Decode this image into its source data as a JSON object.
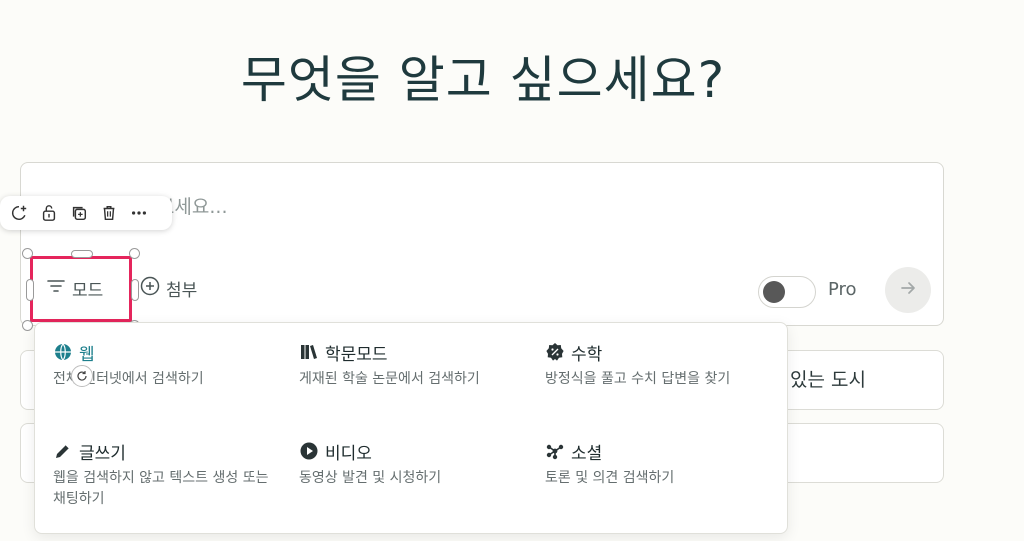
{
  "heading": "무엇을 알고 싶으세요?",
  "search": {
    "placeholder": "무엇이든 물어보세요..."
  },
  "toolbar": {
    "mode_label": "모드",
    "attach_label": "첨부",
    "pro_label": "Pro",
    "pro_enabled": false
  },
  "background_row_text": "있는 도시",
  "mode_menu": {
    "options": [
      {
        "icon": "globe-icon",
        "label": "웹",
        "desc": "전체 인터넷에서 검색하기",
        "active": true
      },
      {
        "icon": "books-icon",
        "label": "학문모드",
        "desc": "게재된 학술 논문에서 검색하기"
      },
      {
        "icon": "math-icon",
        "label": "수학",
        "desc": "방정식을 풀고 수치 답변을 찾기"
      },
      {
        "icon": "pencil-icon",
        "label": "글쓰기",
        "desc": "웹을 검색하지 않고 텍스트 생성 또는 채팅하기"
      },
      {
        "icon": "play-icon",
        "label": "비디오",
        "desc": "동영상 발견 및 시청하기"
      },
      {
        "icon": "network-icon",
        "label": "소셜",
        "desc": "토론 및 의견 검색하기"
      }
    ]
  },
  "colors": {
    "accent": "#1d7f8c",
    "selection": "#e5255c",
    "background": "#fcfcf9"
  }
}
